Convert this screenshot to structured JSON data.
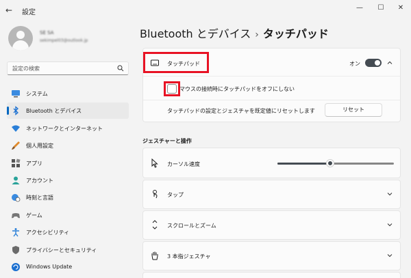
{
  "window": {
    "title": "設定"
  },
  "account": {
    "name": "SE SA",
    "email": "sekimpel03@outlook.jp"
  },
  "search": {
    "placeholder": "設定の検索"
  },
  "sidebar": {
    "items": [
      {
        "label": "システム",
        "icon": "monitor-icon"
      },
      {
        "label": "Bluetooth とデバイス",
        "icon": "bluetooth-icon",
        "active": true
      },
      {
        "label": "ネットワークとインターネット",
        "icon": "wifi-icon"
      },
      {
        "label": "個人用設定",
        "icon": "brush-icon"
      },
      {
        "label": "アプリ",
        "icon": "apps-icon"
      },
      {
        "label": "アカウント",
        "icon": "person-icon"
      },
      {
        "label": "時刻と言語",
        "icon": "globe-clock-icon"
      },
      {
        "label": "ゲーム",
        "icon": "gamepad-icon"
      },
      {
        "label": "アクセシビリティ",
        "icon": "accessibility-icon"
      },
      {
        "label": "プライバシーとセキュリティ",
        "icon": "shield-icon"
      },
      {
        "label": "Windows Update",
        "icon": "update-icon"
      }
    ]
  },
  "header": {
    "parent": "Bluetooth とデバイス",
    "separator": "›",
    "current": "タッチパッド"
  },
  "touchpad": {
    "label": "タッチパッド",
    "toggle_state": "オン",
    "toggle_on": true,
    "mouse_option_label": "マウスの接続時にタッチパッドをオフにしない",
    "mouse_option_checked": false,
    "reset_label": "タッチパッドの設定とジェスチャを既定値にリセットします",
    "reset_button": "リセット"
  },
  "gestures": {
    "title": "ジェスチャーと操作",
    "cursor_speed_label": "カーソル速度",
    "cursor_speed_value": 0.45,
    "rows": [
      {
        "label": "タップ",
        "icon": "tap-icon"
      },
      {
        "label": "スクロールとズーム",
        "icon": "scroll-icon"
      },
      {
        "label": "3 本指ジェスチャ",
        "icon": "hand-icon"
      }
    ]
  },
  "colors": {
    "accent": "#0067c0",
    "highlight": "#e81224",
    "toggle": "#444b52"
  }
}
